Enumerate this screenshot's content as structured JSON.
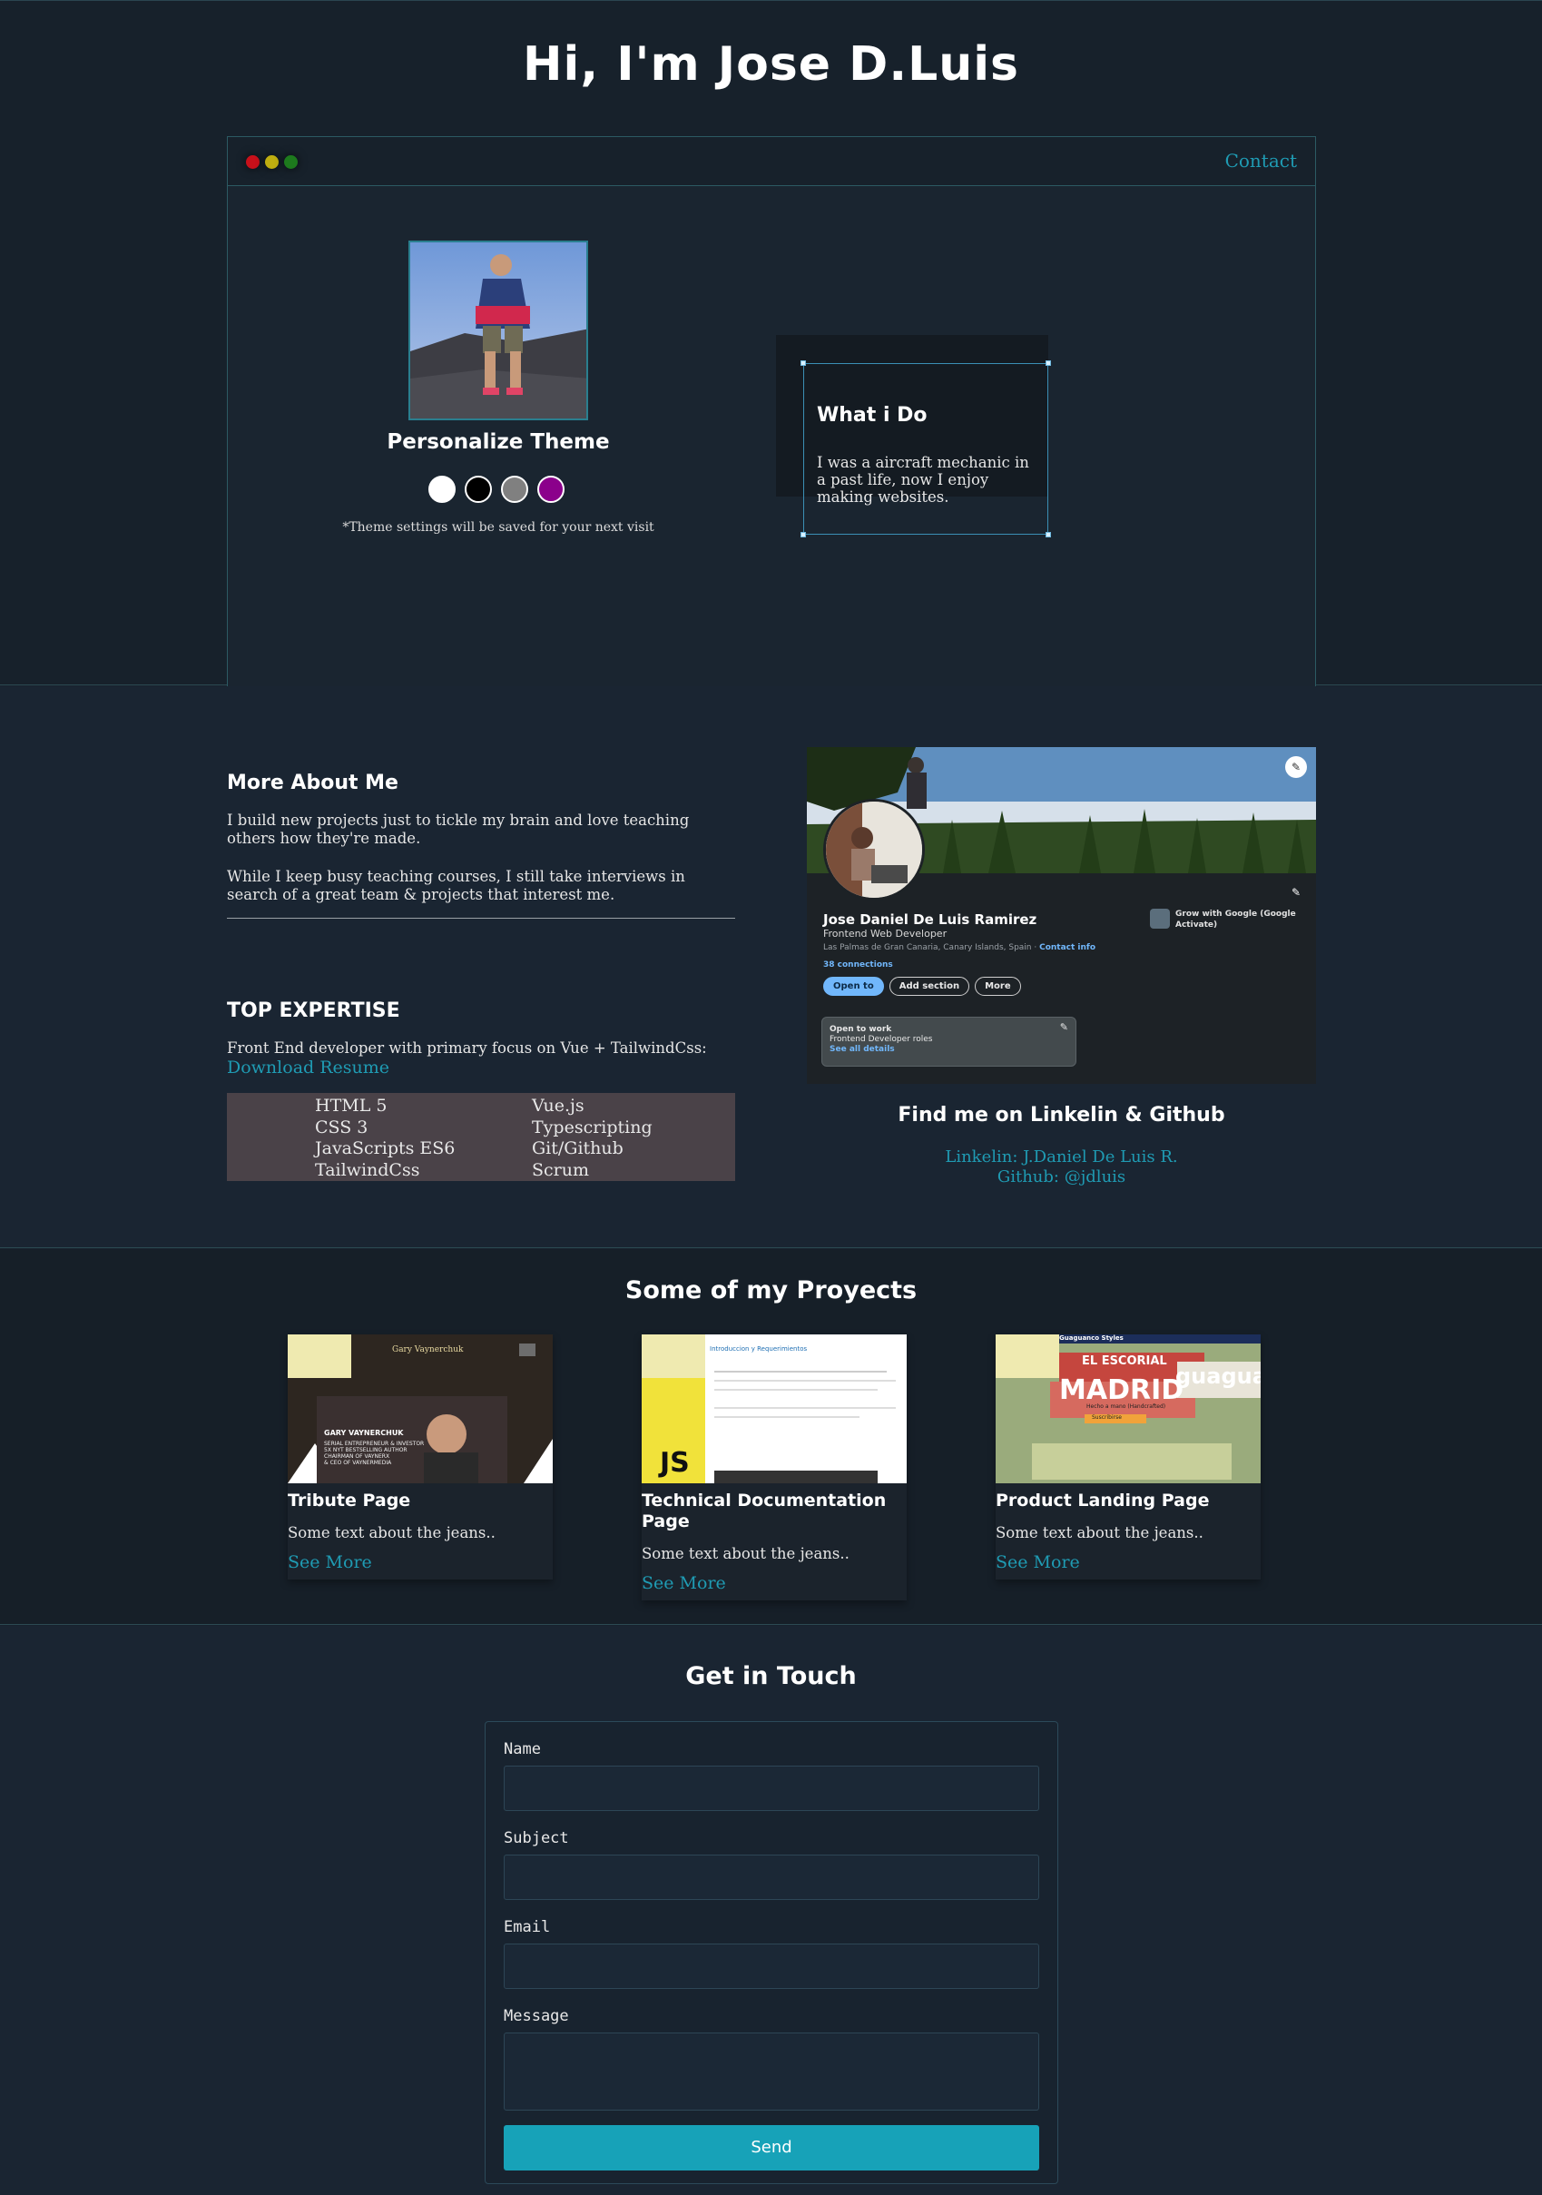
{
  "hero": {
    "title": "Hi, I'm Jose D.Luis",
    "nav_contact": "Contact",
    "window_dots": [
      "#c8101a",
      "#bfae10",
      "#1d7a1d"
    ],
    "theme_title": "Personalize Theme",
    "theme_colors": [
      "#ffffff",
      "#000000",
      "#808080",
      "#8b008b"
    ],
    "theme_note": "*Theme settings will be saved for your next visit",
    "what_title": "What i Do",
    "what_text": "I was a aircraft mechanic in a past life, now I enjoy making websites."
  },
  "about": {
    "title": "More About Me",
    "p1": "I build new projects just to tickle my brain and love teaching others how they're made.",
    "p2": "While I keep busy teaching courses, I still take interviews in search of a great team & projects that interest me.",
    "expertise_title": "TOP EXPERTISE",
    "expertise_text": "Front End developer with primary focus on Vue + TailwindCss:",
    "resume_link": "Download Resume",
    "skills_left": [
      "HTML 5",
      "CSS 3",
      "JavaScripts ES6",
      "TailwindCss"
    ],
    "skills_right": [
      "Vue.js",
      "Typescripting",
      "Git/Github",
      "Scrum"
    ]
  },
  "linkedin": {
    "name": "Jose Daniel De Luis Ramirez",
    "role": "Frontend Web Developer",
    "location": "Las Palmas de Gran Canaria, Canary Islands, Spain · ",
    "contact_info": "Contact info",
    "connections": "38 connections",
    "buttons": [
      "Open to",
      "Add section",
      "More"
    ],
    "google_text": "Grow with Google (Google Activate)",
    "open_title": "Open to work",
    "open_roles": "Frontend Developer roles",
    "open_details": "See all details"
  },
  "find": {
    "title": "Find me on Linkelin & Github",
    "linkedin_link": "Linkelin: J.Daniel De Luis R.",
    "github_link": "Github: @jdluis"
  },
  "projects": {
    "title": "Some of my Proyects",
    "items": [
      {
        "name": "Tribute Page",
        "text": "Some text about the jeans..",
        "more": "See More",
        "thumb_heading": "Gary Vaynerchuk",
        "thumb_caption": "GARY VAYNERCHUK",
        "thumb_lines": [
          "SERIAL ENTREPRENEUR & INVESTOR",
          "5X NYT BESTSELLING AUTHOR",
          "CHAIRMAN OF VAYNERX",
          "& CEO OF VAYNERMEDIA"
        ]
      },
      {
        "name": "Technical Documentation Page",
        "text": "Some text about the jeans..",
        "more": "See More",
        "thumb_heading": "Introduccion y Requerimientos",
        "thumb_badge": "JS"
      },
      {
        "name": "Product Landing Page",
        "text": "Some text about the jeans..",
        "more": "See More",
        "thumb_brand": "Guaguanco Styles",
        "thumb_title": "MADRID",
        "thumb_subtitle": "EL ESCORIAL",
        "thumb_word": "guagua",
        "thumb_tagline": "Hecho a mano (Handcrafted)",
        "thumb_button": "Suscribirse"
      }
    ]
  },
  "contact": {
    "title": "Get in Touch",
    "name_label": "Name",
    "subject_label": "Subject",
    "email_label": "Email",
    "message_label": "Message",
    "send": "Send"
  }
}
